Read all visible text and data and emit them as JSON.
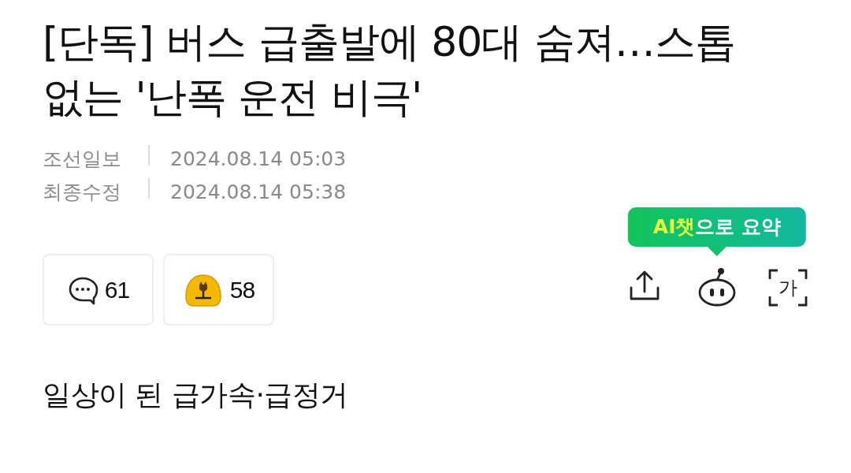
{
  "headline": "[단독] 버스 급출발에 80대 숨져…스톱 없는 '난폭 운전 비극'",
  "meta": [
    {
      "label": "조선일보",
      "value": "2024.08.14 05:03"
    },
    {
      "label": "최종수정",
      "value": "2024.08.14 05:38"
    }
  ],
  "reactions": [
    {
      "kind": "comment",
      "count": "61"
    },
    {
      "kind": "emoji",
      "count": "58"
    }
  ],
  "tooltip": {
    "highlight": "AI챗",
    "text": "으로 요약"
  },
  "tools": [
    {
      "kind": "share"
    },
    {
      "kind": "ai_chat"
    },
    {
      "kind": "font",
      "label": "가"
    }
  ],
  "subheading": "일상이 된 급가속·급정거"
}
